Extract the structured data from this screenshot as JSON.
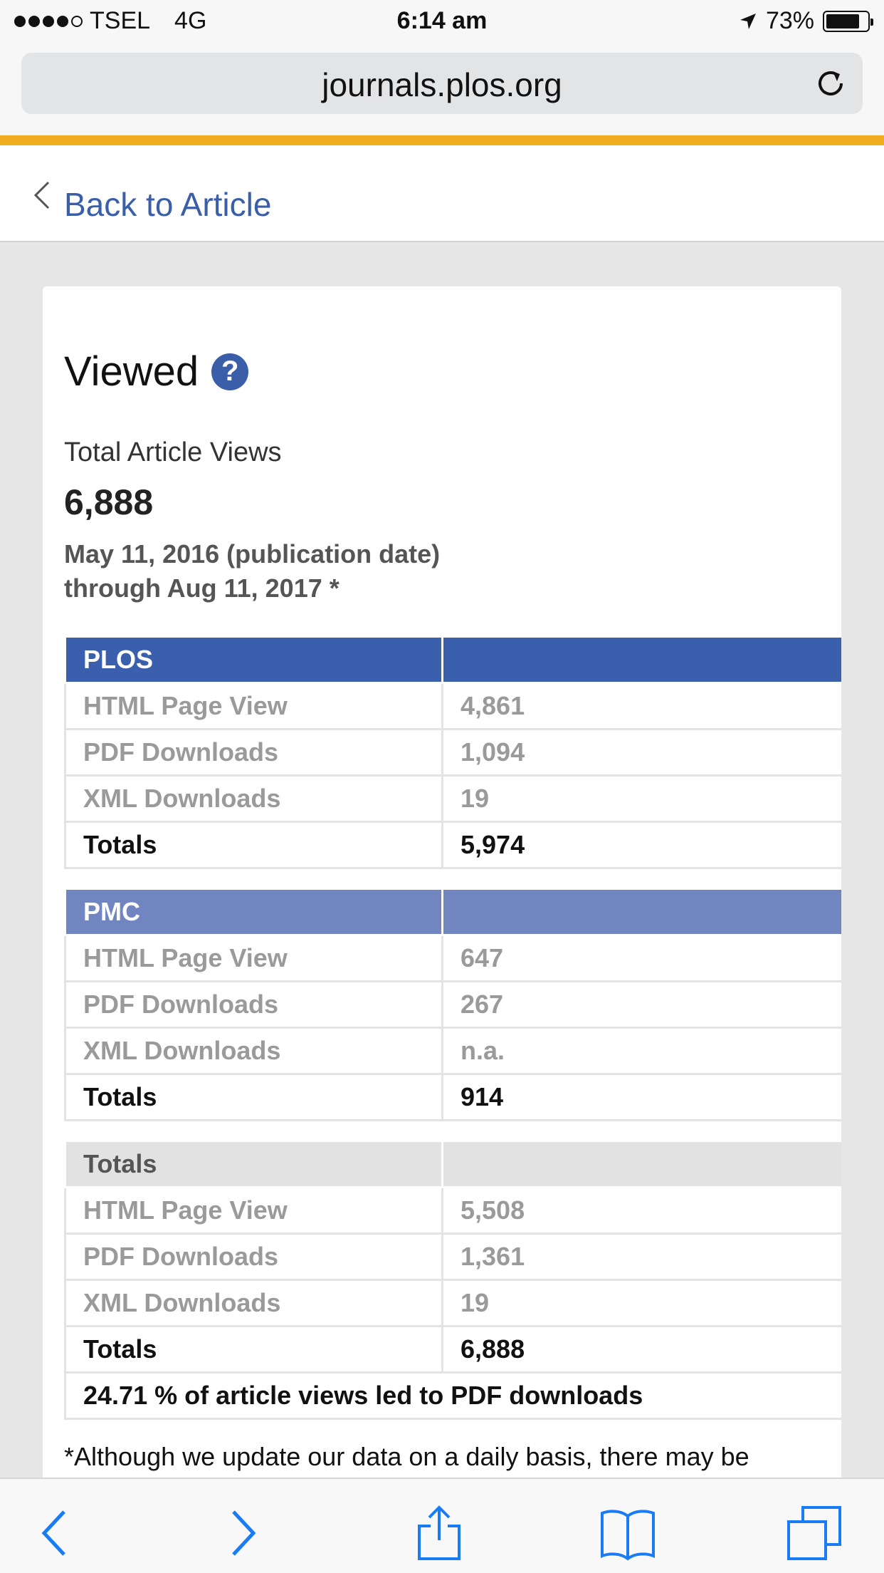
{
  "status_bar": {
    "carrier": "TSEL",
    "network": "4G",
    "time": "6:14 am",
    "battery": "73%"
  },
  "browser": {
    "url": "journals.plos.org"
  },
  "nav": {
    "back_label": "Back to Article"
  },
  "viewed": {
    "title": "Viewed",
    "help_glyph": "?",
    "total_label": "Total Article Views",
    "total_value": "6,888",
    "date_line1": "May 11, 2016 (publication date)",
    "date_line2": "through Aug 11, 2017 *"
  },
  "tables": {
    "plos": {
      "header": "PLOS",
      "rows": [
        {
          "label": "HTML Page View",
          "value": "4,861"
        },
        {
          "label": "PDF Downloads",
          "value": "1,094"
        },
        {
          "label": "XML Downloads",
          "value": "19"
        }
      ],
      "totals_label": "Totals",
      "totals_value": "5,974"
    },
    "pmc": {
      "header": "PMC",
      "rows": [
        {
          "label": "HTML Page View",
          "value": "647"
        },
        {
          "label": "PDF Downloads",
          "value": "267"
        },
        {
          "label": "XML Downloads",
          "value": "n.a."
        }
      ],
      "totals_label": "Totals",
      "totals_value": "914"
    },
    "totals": {
      "header": "Totals",
      "rows": [
        {
          "label": "HTML Page View",
          "value": "5,508"
        },
        {
          "label": "PDF Downloads",
          "value": "1,361"
        },
        {
          "label": "XML Downloads",
          "value": "19"
        }
      ],
      "totals_label": "Totals",
      "totals_value": "6,888",
      "pdf_ratio": "24.71 % of article views led to PDF downloads"
    }
  },
  "footnote": "*Although we update our data on a daily basis, there may be",
  "colors": {
    "accent_orange": "#f0ad1e",
    "plos_blue": "#3a5fad",
    "pmc_blue": "#7185c0",
    "link_blue": "#3a5ea8",
    "ios_blue": "#1a7cf5"
  }
}
